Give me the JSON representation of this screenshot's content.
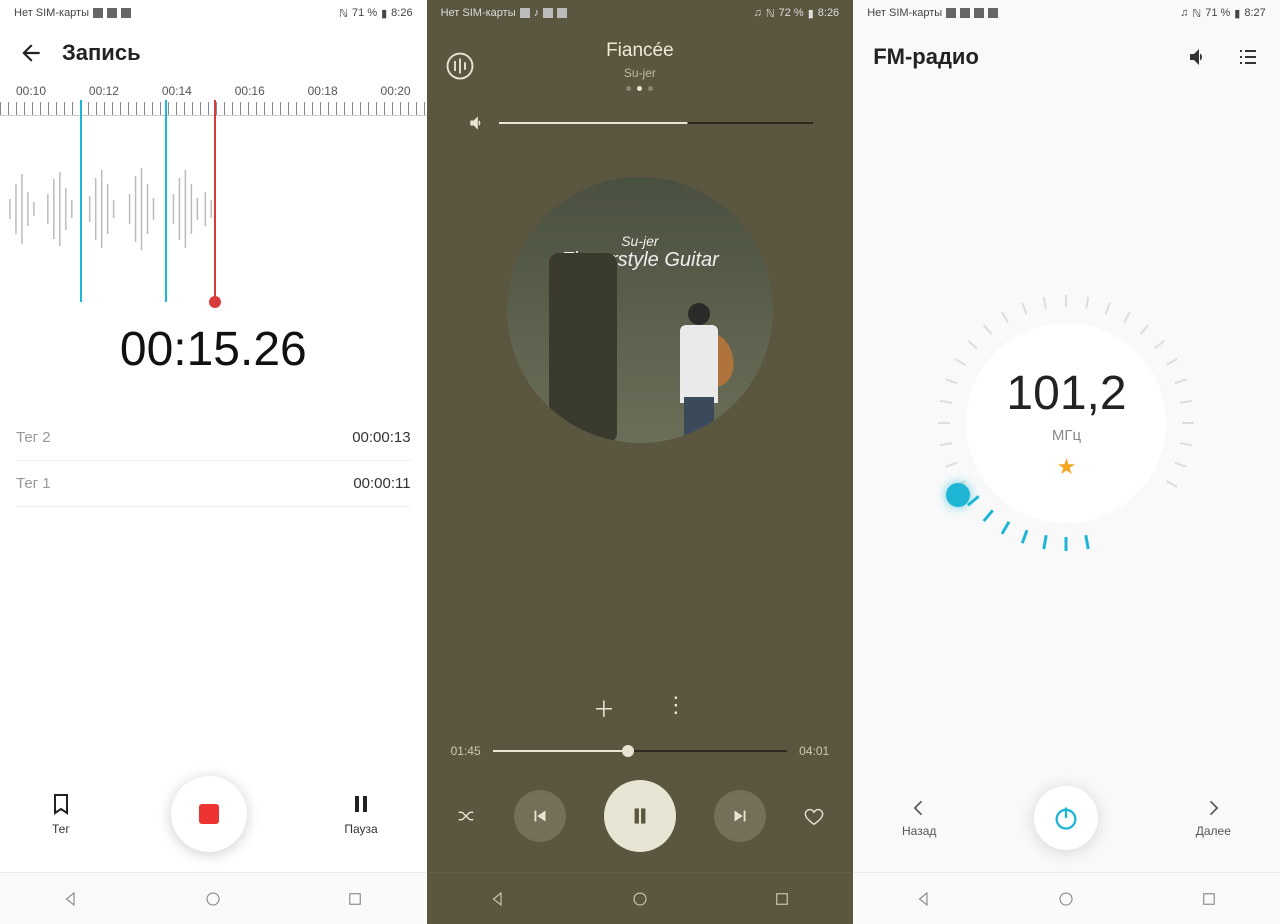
{
  "recorder": {
    "statusbar": {
      "sim": "Нет SIM-карты",
      "battery": "71 %",
      "time": "8:26"
    },
    "title": "Запись",
    "ticks": [
      "00:10",
      "00:12",
      "00:14",
      "00:16",
      "00:18",
      "00:20"
    ],
    "elapsed": "00:15.26",
    "tags": [
      {
        "label": "Тег 2",
        "time": "00:00:13"
      },
      {
        "label": "Тег 1",
        "time": "00:00:11"
      }
    ],
    "btn_tag": "Тег",
    "btn_pause": "Пауза"
  },
  "music": {
    "statusbar": {
      "sim": "Нет SIM-карты",
      "battery": "72 %",
      "time": "8:26"
    },
    "title": "Fiancée",
    "artist": "Su-jer",
    "album_line1": "Su-jer",
    "album_line2": "Fingerstyle Guitar",
    "elapsed": "01:45",
    "total": "04:01"
  },
  "radio": {
    "statusbar": {
      "sim": "Нет SIM-карты",
      "battery": "71 %",
      "time": "8:27"
    },
    "title": "FM-радио",
    "frequency": "101,2",
    "unit": "МГц",
    "star": "★",
    "btn_prev": "Назад",
    "btn_next": "Далее"
  }
}
